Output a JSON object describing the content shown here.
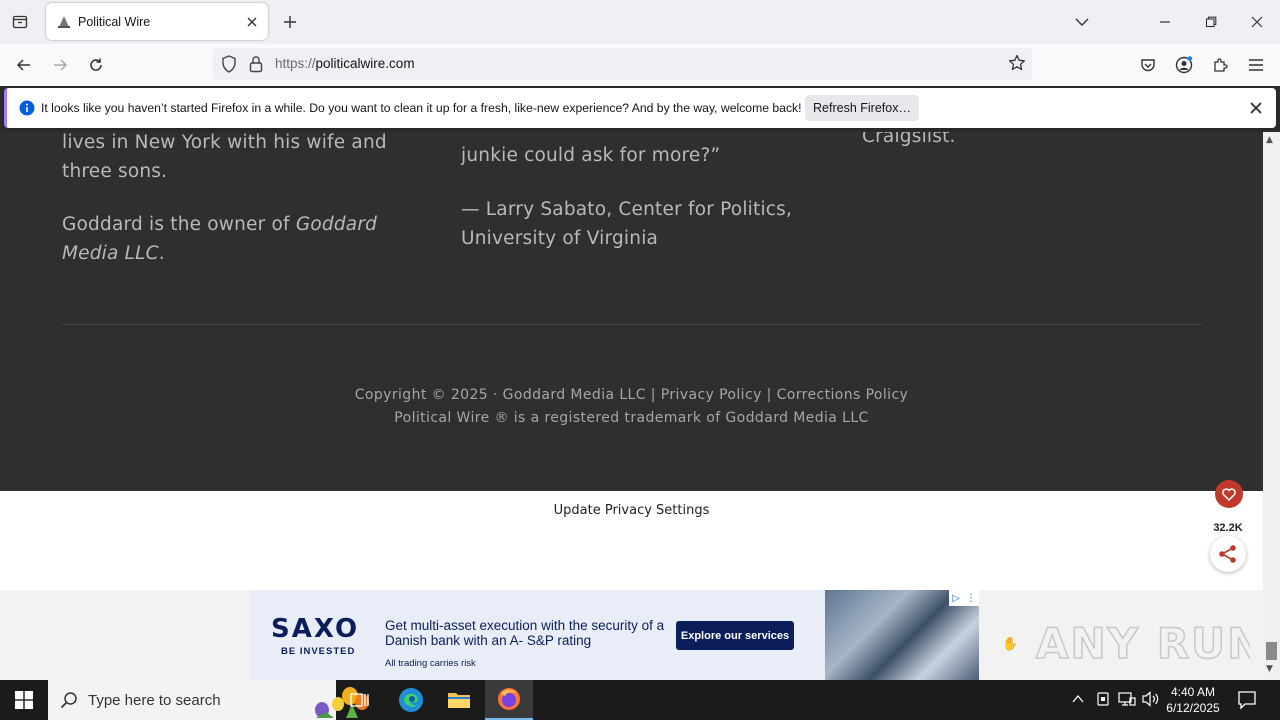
{
  "browser": {
    "tab": {
      "title": "Political Wire"
    },
    "url": {
      "scheme": "https://",
      "host": "politicalwire.com"
    }
  },
  "notification": {
    "message": "It looks like you haven’t started Firefox in a while. Do you want to clean it up for a fresh, like-new experience? And by the way, welcome back!",
    "button": "Refresh Firefox…"
  },
  "content": {
    "col1": {
      "line1": "lives in New York with his wife and",
      "line2": "three sons.",
      "owner_prefix": "Goddard is the owner of ",
      "owner_company_line1": "Goddard",
      "owner_company_line2": "Media LLC",
      "owner_suffix": "."
    },
    "col2": {
      "line1": "junkie could ask for more?”",
      "attribution_line1": "— Larry Sabato, Center for Politics,",
      "attribution_line2": "University of Virginia"
    },
    "col3": {
      "line1": "Craigslist."
    },
    "footer": {
      "copyright": "Copyright © 2025 · Goddard Media LLC",
      "sep": " | ",
      "privacy": "Privacy Policy",
      "corrections": "Corrections Policy",
      "trademark": "Political Wire ® is a registered trademark of Goddard Media LLC"
    },
    "privacy_settings": "Update Privacy Settings"
  },
  "share": {
    "count": "32.2K"
  },
  "ad": {
    "brand": "SAXO",
    "tagline": "BE INVESTED",
    "headline": "Get multi-asset execution with the security of a Danish bank with an A- S&P rating",
    "cta": "Explore our services",
    "disclaimer": "All trading carries risk"
  },
  "watermark": {
    "text": "ANY RUN"
  },
  "taskbar": {
    "search_placeholder": "Type here to search",
    "time": "4:40 AM",
    "date": "6/12/2025"
  },
  "colors": {
    "page_bg": "#2f2f2f",
    "accent_purple": "#a47ef9",
    "saxo_navy": "#0a1e5c",
    "heart_red": "#c0392b"
  }
}
